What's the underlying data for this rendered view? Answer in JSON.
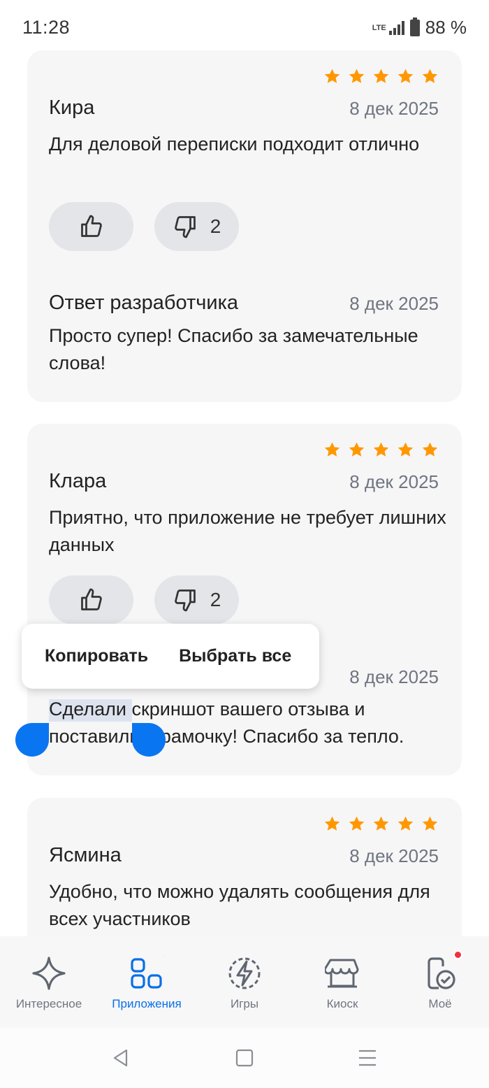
{
  "status_bar": {
    "time": "11:28",
    "network": "LTE",
    "battery": "88 %"
  },
  "reviews": [
    {
      "name": "Кира",
      "date": "8 дек 2025",
      "stars": 5,
      "text": "Для деловой переписки подходит отлично",
      "dislike_count": "2",
      "reply_title": "Ответ разработчика",
      "reply_date": "8 дек 2025",
      "reply_text": "Просто супер! Спасибо за замечательные слова!"
    },
    {
      "name": "Клара",
      "date": "8 дек 2025",
      "stars": 5,
      "text": "Приятно, что приложение не требует лишних данных",
      "dislike_count": "2",
      "reply_date": "8 дек 2025",
      "reply_text": "Сделали скриншот вашего отзыва и поставили в рамочку! Спасибо за тепло."
    },
    {
      "name": "Ясмина",
      "date": "8 дек 2025",
      "stars": 5,
      "text": "Удобно, что можно удалять сообщения для всех участников"
    }
  ],
  "context_menu": {
    "copy": "Копировать",
    "select_all": "Выбрать все"
  },
  "bottom_nav": [
    {
      "label": "Интересное",
      "icon": "sparkle-icon",
      "active": false
    },
    {
      "label": "Приложения",
      "icon": "apps-grid-icon",
      "active": true
    },
    {
      "label": "Игры",
      "icon": "lightning-icon",
      "active": false
    },
    {
      "label": "Киоск",
      "icon": "storefront-icon",
      "active": false
    },
    {
      "label": "Моё",
      "icon": "my-apps-icon",
      "active": false
    }
  ],
  "colors": {
    "accent": "#0a6fe8",
    "star": "#ff9800",
    "card_bg": "#f6f6f7",
    "badge": "#f0313f"
  }
}
